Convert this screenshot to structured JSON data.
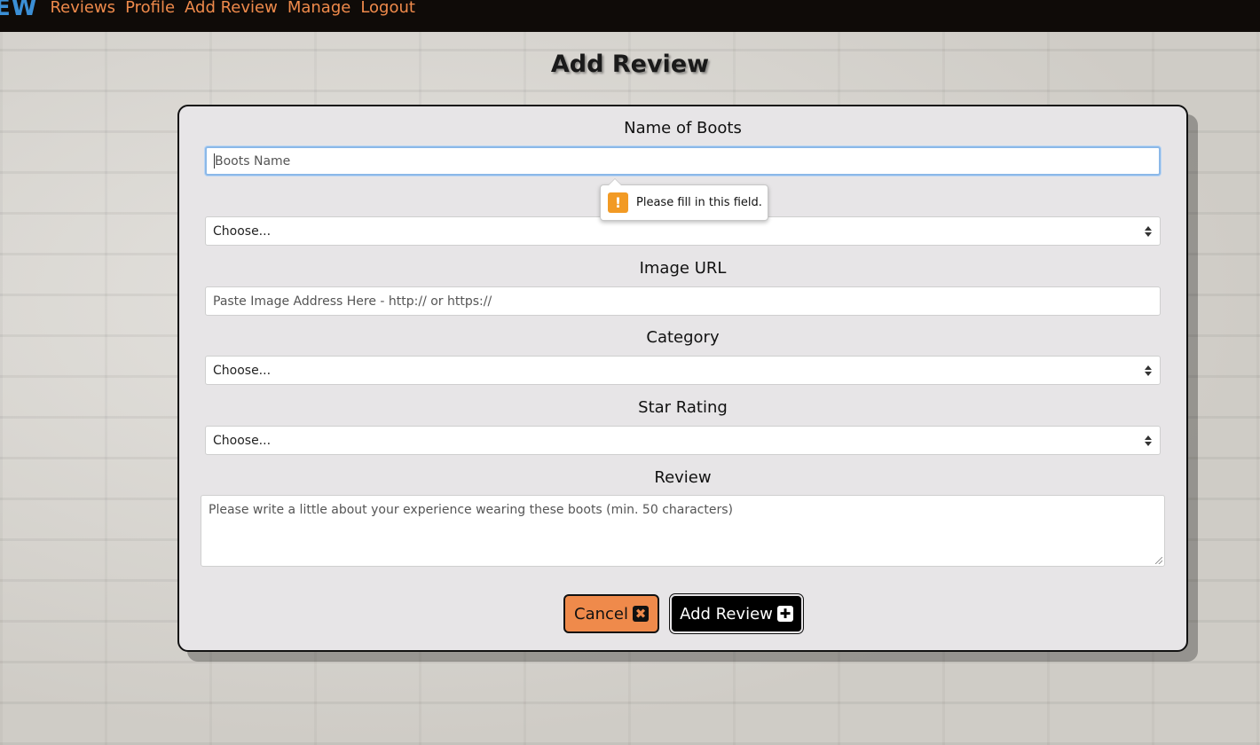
{
  "nav": {
    "brand": "EW",
    "links": [
      "Reviews",
      "Profile",
      "Add Review",
      "Manage",
      "Logout"
    ]
  },
  "page": {
    "title": "Add Review"
  },
  "form": {
    "boots_name": {
      "label": "Name of Boots",
      "placeholder": "Boots Name"
    },
    "validation_tooltip": "Please fill in this field.",
    "brand_select": {
      "value": "Choose..."
    },
    "image_url": {
      "label": "Image URL",
      "placeholder": "Paste Image Address Here - http:// or https://"
    },
    "category": {
      "label": "Category",
      "value": "Choose..."
    },
    "star_rating": {
      "label": "Star Rating",
      "value": "Choose..."
    },
    "review": {
      "label": "Review",
      "placeholder": "Please write a little about your experience wearing these boots (min. 50 characters)"
    },
    "buttons": {
      "cancel": "Cancel",
      "cancel_icon": "✖",
      "add": "Add Review",
      "add_icon": "✚"
    }
  },
  "colors": {
    "accent": "#ef8a4b",
    "brand_blue": "#3b8fd6",
    "navbar_bg": "#0f0b08",
    "card_bg": "#e7e5e7",
    "warning": "#f29a24"
  }
}
